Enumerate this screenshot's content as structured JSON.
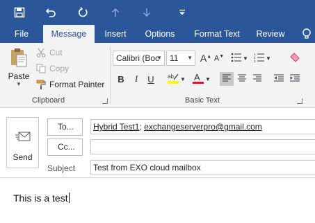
{
  "qat": {
    "icons": [
      "save-icon",
      "undo-icon",
      "redo-icon",
      "up-arrow-icon",
      "down-arrow-icon",
      "customize-toolbar-icon"
    ]
  },
  "tabs": [
    {
      "label": "File"
    },
    {
      "label": "Message",
      "active": true
    },
    {
      "label": "Insert"
    },
    {
      "label": "Options"
    },
    {
      "label": "Format Text"
    },
    {
      "label": "Review"
    }
  ],
  "ribbon": {
    "clipboard": {
      "label": "Clipboard",
      "paste": "Paste",
      "cut": "Cut",
      "copy": "Copy",
      "format_painter": "Format Painter"
    },
    "basic_text": {
      "label": "Basic Text",
      "font_name": "Calibri (Boc",
      "font_size": "11",
      "bold": "B",
      "italic": "I",
      "underline": "U"
    }
  },
  "compose": {
    "send": "Send",
    "to_button": "To...",
    "cc_button": "Cc...",
    "subject_label": "Subject",
    "to_recipients": [
      "Hybrid Test1",
      "exchangeserverpro@gmail.com"
    ],
    "to_separator": "; ",
    "cc_value": "",
    "subject_value": "Test from EXO cloud mailbox",
    "body": "This is a test"
  },
  "colors": {
    "accent": "#2b579a",
    "ribbon_bg": "#f3f3f3",
    "highlight_yellow": "#ffff00",
    "font_red": "#e81123"
  }
}
